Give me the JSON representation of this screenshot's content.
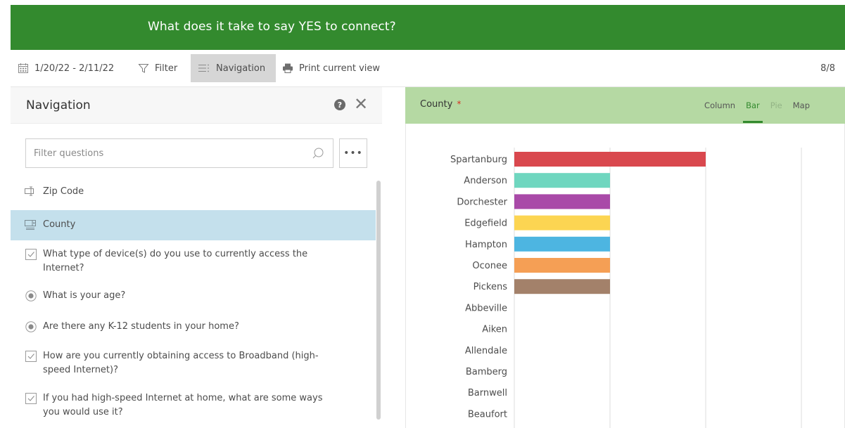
{
  "banner": {
    "title": "What does it take to say YES to connect?"
  },
  "toolbar": {
    "date_range": "1/20/22 - 2/11/22",
    "filter_label": "Filter",
    "navigation_label": "Navigation",
    "print_label": "Print current view",
    "page_indicator": "8/8"
  },
  "nav": {
    "title": "Navigation",
    "help_glyph": "?",
    "close_glyph": "✕",
    "filter_placeholder": "Filter questions",
    "more_label": "•••",
    "items": [
      {
        "label": "Zip Code",
        "icon": "text-field-icon"
      },
      {
        "label": "County",
        "icon": "dropdown-icon",
        "selected": true
      },
      {
        "label": "What type of device(s) do you use to currently access the Internet?",
        "icon": "checkbox-icon"
      },
      {
        "label": "What is your age?",
        "icon": "radio-icon"
      },
      {
        "label": "Are there any K-12 students in your home?",
        "icon": "radio-icon"
      },
      {
        "label": "How are you currently obtaining access to Broadband (high-speed Internet)?",
        "icon": "checkbox-icon"
      },
      {
        "label": "If you had high-speed Internet at home, what are some ways you would use it?",
        "icon": "checkbox-icon"
      }
    ]
  },
  "chart_panel": {
    "title": "County",
    "required_mark": "*",
    "tabs": [
      {
        "label": "Column",
        "state": "normal"
      },
      {
        "label": "Bar",
        "state": "active"
      },
      {
        "label": "Pie",
        "state": "disabled"
      },
      {
        "label": "Map",
        "state": "normal"
      }
    ]
  },
  "chart_data": {
    "type": "bar",
    "orientation": "horizontal",
    "categories": [
      "Spartanburg",
      "Anderson",
      "Dorchester",
      "Edgefield",
      "Hampton",
      "Oconee",
      "Pickens",
      "Abbeville",
      "Aiken",
      "Allendale",
      "Bamberg",
      "Barnwell",
      "Beaufort"
    ],
    "values": [
      2,
      1,
      1,
      1,
      1,
      1,
      1,
      0,
      0,
      0,
      0,
      0,
      0
    ],
    "colors": [
      "#d9484e",
      "#6fd6bf",
      "#a94aa8",
      "#fcd552",
      "#4db5e1",
      "#f59f55",
      "#a3816a",
      "#cccccc",
      "#cccccc",
      "#cccccc",
      "#cccccc",
      "#cccccc",
      "#cccccc"
    ],
    "xlim": [
      0,
      3
    ],
    "grid": true
  }
}
